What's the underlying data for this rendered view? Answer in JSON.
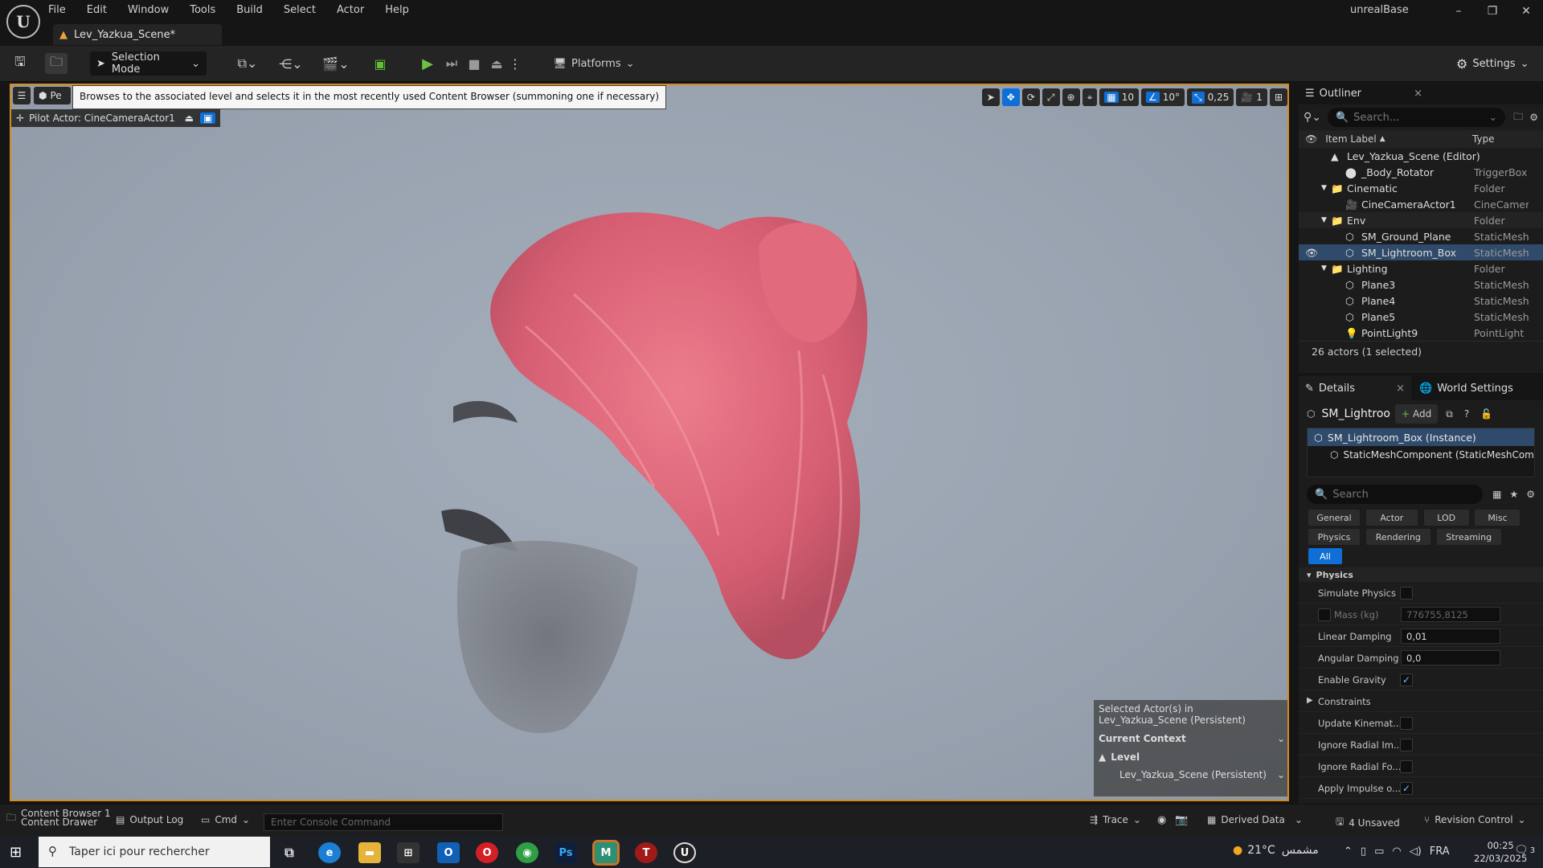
{
  "menu": [
    "File",
    "Edit",
    "Window",
    "Tools",
    "Build",
    "Select",
    "Actor",
    "Help"
  ],
  "project_name": "unrealBase",
  "level_tab": "Lev_Yazkua_Scene*",
  "toolbar": {
    "selection_mode": "Selection Mode",
    "platforms": "Platforms",
    "settings": "Settings"
  },
  "viewport": {
    "perspective_short": "Pe",
    "tooltip": "Browses to the associated level and selects it in the most recently used Content Browser (summoning one if necessary)",
    "pilot_actor": "Pilot Actor: CineCameraActor1",
    "grid_snap": "10",
    "rot_snap": "10°",
    "scale_snap": "0,25",
    "camera_speed": "1",
    "context": {
      "selected_line1": "Selected Actor(s) in",
      "selected_line2": "Lev_Yazkua_Scene (Persistent)",
      "current_context": "Current Context",
      "level_label": "Level",
      "level_value": "Lev_Yazkua_Scene (Persistent)"
    }
  },
  "outliner": {
    "title": "Outliner",
    "search_placeholder": "Search...",
    "col_label": "Item Label",
    "col_type": "Type",
    "rows": [
      {
        "label": "Lev_Yazkua_Scene (Editor)",
        "type": "",
        "indent": 0
      },
      {
        "label": "_Body_Rotator",
        "type": "TriggerBox",
        "indent": 1
      },
      {
        "label": "Cinematic",
        "type": "Folder",
        "indent": 0
      },
      {
        "label": "CineCameraActor1",
        "type": "CineCamera",
        "indent": 1
      },
      {
        "label": "Env",
        "type": "Folder",
        "indent": 0
      },
      {
        "label": "SM_Ground_Plane",
        "type": "StaticMesh",
        "indent": 1
      },
      {
        "label": "SM_Lightroom_Box",
        "type": "StaticMesh",
        "indent": 1
      },
      {
        "label": "Lighting",
        "type": "Folder",
        "indent": 0
      },
      {
        "label": "Plane3",
        "type": "StaticMesh",
        "indent": 1
      },
      {
        "label": "Plane4",
        "type": "StaticMesh",
        "indent": 1
      },
      {
        "label": "Plane5",
        "type": "StaticMesh",
        "indent": 1
      },
      {
        "label": "PointLight9",
        "type": "PointLight",
        "indent": 1
      }
    ],
    "count": "26 actors (1 selected)"
  },
  "details": {
    "tab_details": "Details",
    "tab_world": "World Settings",
    "actor_name": "SM_Lightroo",
    "add": "Add",
    "instance": "SM_Lightroom_Box (Instance)",
    "component": "StaticMeshComponent (StaticMeshComp",
    "search_placeholder": "Search",
    "categories_row1": [
      "General",
      "Actor",
      "LOD",
      "Misc"
    ],
    "categories_row2": [
      "Physics",
      "Rendering",
      "Streaming"
    ],
    "category_all": "All",
    "section": "Physics",
    "props": {
      "simulate_physics": "Simulate Physics",
      "mass": "Mass (kg)",
      "mass_value": "776755,8125",
      "linear_damping": "Linear Damping",
      "linear_value": "0,01",
      "angular_damping": "Angular Damping",
      "angular_value": "0,0",
      "enable_gravity": "Enable Gravity",
      "constraints": "Constraints",
      "update_kinematic": "Update Kinemat...",
      "ignore_radial_im": "Ignore Radial Im...",
      "ignore_radial_fo": "Ignore Radial Fo...",
      "apply_impulse": "Apply Impulse o..."
    }
  },
  "statusbar": {
    "content_drawer": "Content Drawer",
    "content_browser": "Content Browser 1",
    "output_log": "Output Log",
    "cmd": "Cmd",
    "console_placeholder": "Enter Console Command",
    "trace": "Trace",
    "derived_data": "Derived Data",
    "unsaved": "4 Unsaved",
    "revision": "Revision Control"
  },
  "taskbar": {
    "search_placeholder": "Taper ici pour rechercher",
    "weather": "21°C",
    "weather_text": "مشمس",
    "lang": "FRA",
    "time": "00:25",
    "date": "22/03/2025",
    "notif_count": "3"
  },
  "colors": {
    "accent_blue": "#0f6fd6",
    "viewport_border": "#d58b1f",
    "hair": "#e3667a",
    "beard": "#5a5d63"
  }
}
